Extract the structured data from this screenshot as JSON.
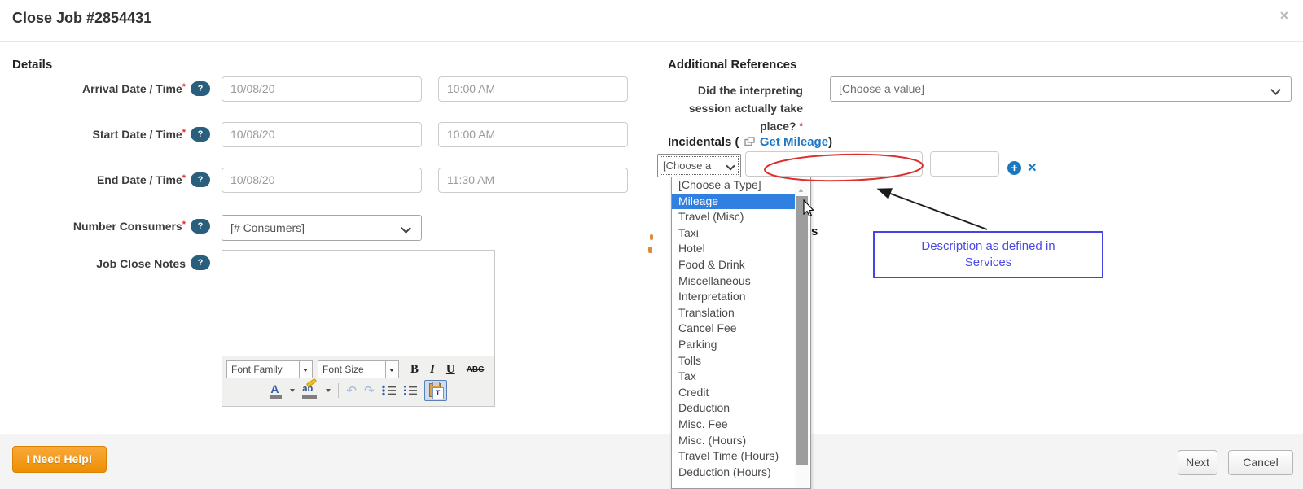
{
  "window": {
    "title": "Close Job #2854431"
  },
  "icons": {
    "close": "✕",
    "help": "?",
    "plus": "+",
    "remove": "✕",
    "scroll_up": "▲"
  },
  "details": {
    "heading": "Details",
    "required_mark": "*",
    "rows": [
      {
        "label": "Arrival Date / Time",
        "date": "10/08/20",
        "time": "10:00 AM"
      },
      {
        "label": "Start Date / Time",
        "date": "10/08/20",
        "time": "10:00 AM"
      },
      {
        "label": "End Date / Time",
        "date": "10/08/20",
        "time": "11:30 AM"
      }
    ],
    "number_consumers": {
      "label": "Number Consumers",
      "value": "[# Consumers]"
    },
    "notes": {
      "label": "Job Close Notes"
    }
  },
  "editor": {
    "font_family": "Font Family",
    "font_size": "Font Size",
    "bold": "B",
    "italic": "I",
    "underline": "U",
    "strike": "ABC",
    "forecolor": "A",
    "backcolor": "ab",
    "undo": "↶",
    "redo": "↷",
    "paste_text": "T"
  },
  "additional": {
    "heading": "Additional References",
    "question": {
      "lines": [
        "Did the interpreting",
        "session actually take",
        "place?"
      ],
      "value": "[Choose a value]"
    },
    "incidentals": {
      "prefix": "Incidentals (",
      "link": "Get Mileage",
      "suffix": ")",
      "type_value": "[Choose a",
      "dropdown": {
        "items": [
          "[Choose a Type]",
          "Mileage",
          "Travel (Misc)",
          "Taxi",
          "Hotel",
          "Food & Drink",
          "Miscellaneous",
          "Interpretation",
          "Translation",
          "Cancel Fee",
          "Parking",
          "Tolls",
          "Tax",
          "Credit",
          "Deduction",
          "Misc. Fee",
          "Misc. (Hours)",
          "Travel Time (Hours)",
          "Deduction (Hours)"
        ],
        "highlighted": "Mileage"
      }
    },
    "hidden_fragment": "s"
  },
  "annotation": {
    "note_lines": [
      "Description as defined in",
      "Services"
    ]
  },
  "footer": {
    "help": "I Need Help!",
    "next": "Next",
    "cancel": "Cancel"
  },
  "colors": {
    "accent_blue": "#1b78be",
    "highlight_blue": "#2f80e0",
    "annotation_red": "#dc3030",
    "annotation_blue": "#4543e5",
    "help_button_orange": "#ee8f03",
    "help_pill": "#295e7d",
    "link_blue": "#1d78c4"
  }
}
